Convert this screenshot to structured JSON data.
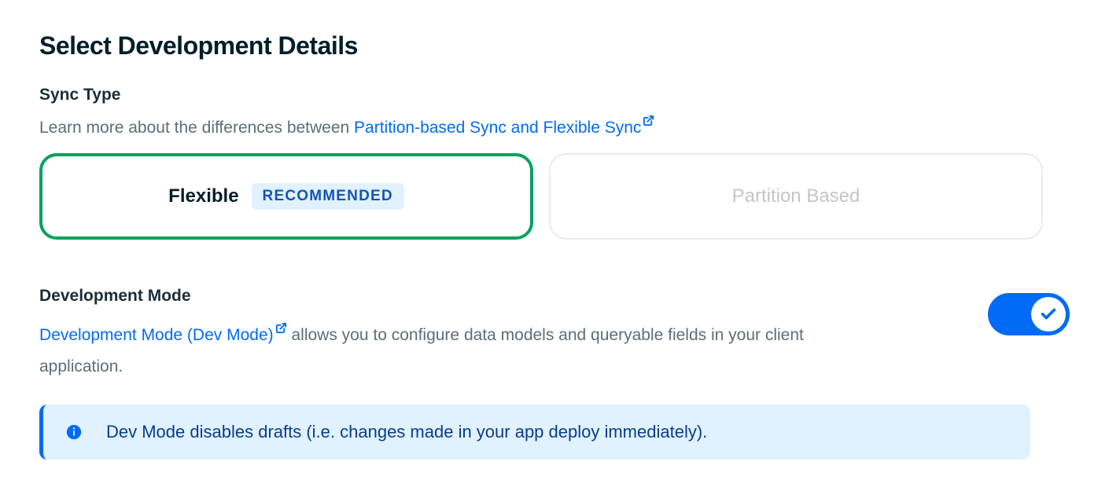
{
  "page": {
    "title": "Select Development Details"
  },
  "sync": {
    "label": "Sync Type",
    "desc_prefix": "Learn more about the differences between ",
    "link_text": "Partition-based Sync and Flexible Sync",
    "options": {
      "flexible": {
        "label": "Flexible",
        "badge": "RECOMMENDED"
      },
      "partition": {
        "label": "Partition Based"
      }
    }
  },
  "dev_mode": {
    "label": "Development Mode",
    "link_text": "Development Mode (Dev Mode)",
    "desc_suffix": "  allows you to configure data models and queryable fields in your client application.",
    "toggle_on": true,
    "banner": "Dev Mode disables drafts (i.e. changes made in your app deploy immediately)."
  }
}
